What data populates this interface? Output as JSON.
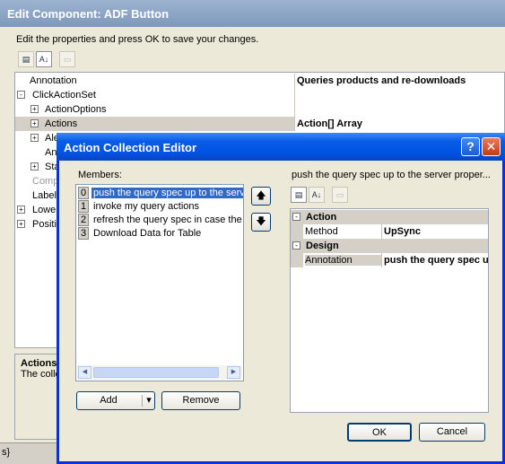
{
  "outer": {
    "title": "Edit Component: ADF Button",
    "description": "Edit the properties and press OK to save your changes.",
    "grid_rows": [
      {
        "name": "Annotation",
        "value": "Queries products and re-downloads",
        "indent": 0,
        "expander": ""
      },
      {
        "name": "ClickActionSet",
        "value": "",
        "indent": 0,
        "expander": "-"
      },
      {
        "name": "ActionOptions",
        "value": "",
        "indent": 1,
        "expander": "+"
      },
      {
        "name": "Actions",
        "value": "Action[] Array",
        "indent": 1,
        "expander": "+"
      },
      {
        "name": "Ale",
        "value": "",
        "indent": 1,
        "expander": "+"
      },
      {
        "name": "An",
        "value": "",
        "indent": 1,
        "expander": ""
      },
      {
        "name": "Sta",
        "value": "",
        "indent": 1,
        "expander": "+"
      },
      {
        "name": "Comp",
        "value": "",
        "indent": 0,
        "expander": ""
      },
      {
        "name": "Label",
        "value": "",
        "indent": 0,
        "expander": ""
      },
      {
        "name": "Lower",
        "value": "",
        "indent": 0,
        "expander": "+"
      },
      {
        "name": "Positio",
        "value": "",
        "indent": 0,
        "expander": "+"
      }
    ],
    "help_title": "Actions",
    "help_text": "The colle",
    "status_text": "s}"
  },
  "dialog": {
    "title": "Action Collection Editor",
    "help_glyph": "?",
    "close_glyph": "✕",
    "members_label": "Members:",
    "members": [
      {
        "index": "0",
        "text": "push the query spec up to the server properties"
      },
      {
        "index": "1",
        "text": "invoke my query actions"
      },
      {
        "index": "2",
        "text": "refresh the query spec in case the server changed it"
      },
      {
        "index": "3",
        "text": "Download Data for Table"
      }
    ],
    "move_up_glyph": "🡅",
    "move_down_glyph": "🡇",
    "add_label": "Add",
    "add_arrow": "▾",
    "remove_label": "Remove",
    "properties_label": "push the query spec up to the server proper...",
    "properties": [
      {
        "type": "category",
        "name": "Action",
        "value": ""
      },
      {
        "type": "prop",
        "name": "Method",
        "value": "UpSync"
      },
      {
        "type": "category",
        "name": "Design",
        "value": ""
      },
      {
        "type": "prop",
        "name": "Annotation",
        "value": "push the query spec up to the server properties"
      }
    ],
    "ok_label": "OK",
    "cancel_label": "Cancel"
  },
  "icons": {
    "categorized": "▤",
    "alphabetical": "A↓",
    "property_pages": "▭"
  }
}
